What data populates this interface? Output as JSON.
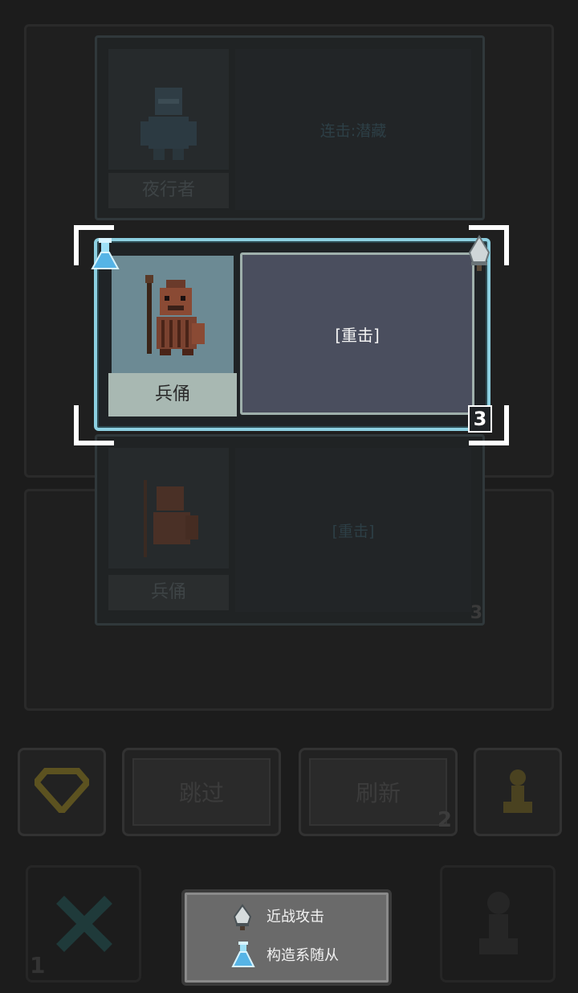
{
  "top_card": {
    "name": "夜行者",
    "description": "连击:潜藏"
  },
  "focused_card": {
    "name": "兵俑",
    "description": "[重击]",
    "level": "3",
    "left_tag_icon": "flask-icon",
    "right_tag_icon": "dagger-icon"
  },
  "lower_card": {
    "name": "兵俑",
    "description": "[重击]",
    "level": "3"
  },
  "actions": {
    "skip_label": "跳过",
    "refresh_label": "刷新",
    "refresh_count": "2",
    "left_icon": "gem-icon",
    "right_icon": "pawn-icon"
  },
  "bottom_bar": {
    "close_count": "1"
  },
  "legend": {
    "items": [
      {
        "icon": "dagger-icon",
        "label": "近战攻击"
      },
      {
        "icon": "flask-icon",
        "label": "构造系随从"
      }
    ]
  },
  "colors": {
    "card_border": "#8ccfe0",
    "portrait_bg": "#6c8a94",
    "name_bg": "#a8b8b2",
    "desc_bg": "#4a4e5e",
    "legend_bg": "#6a6a6a"
  }
}
